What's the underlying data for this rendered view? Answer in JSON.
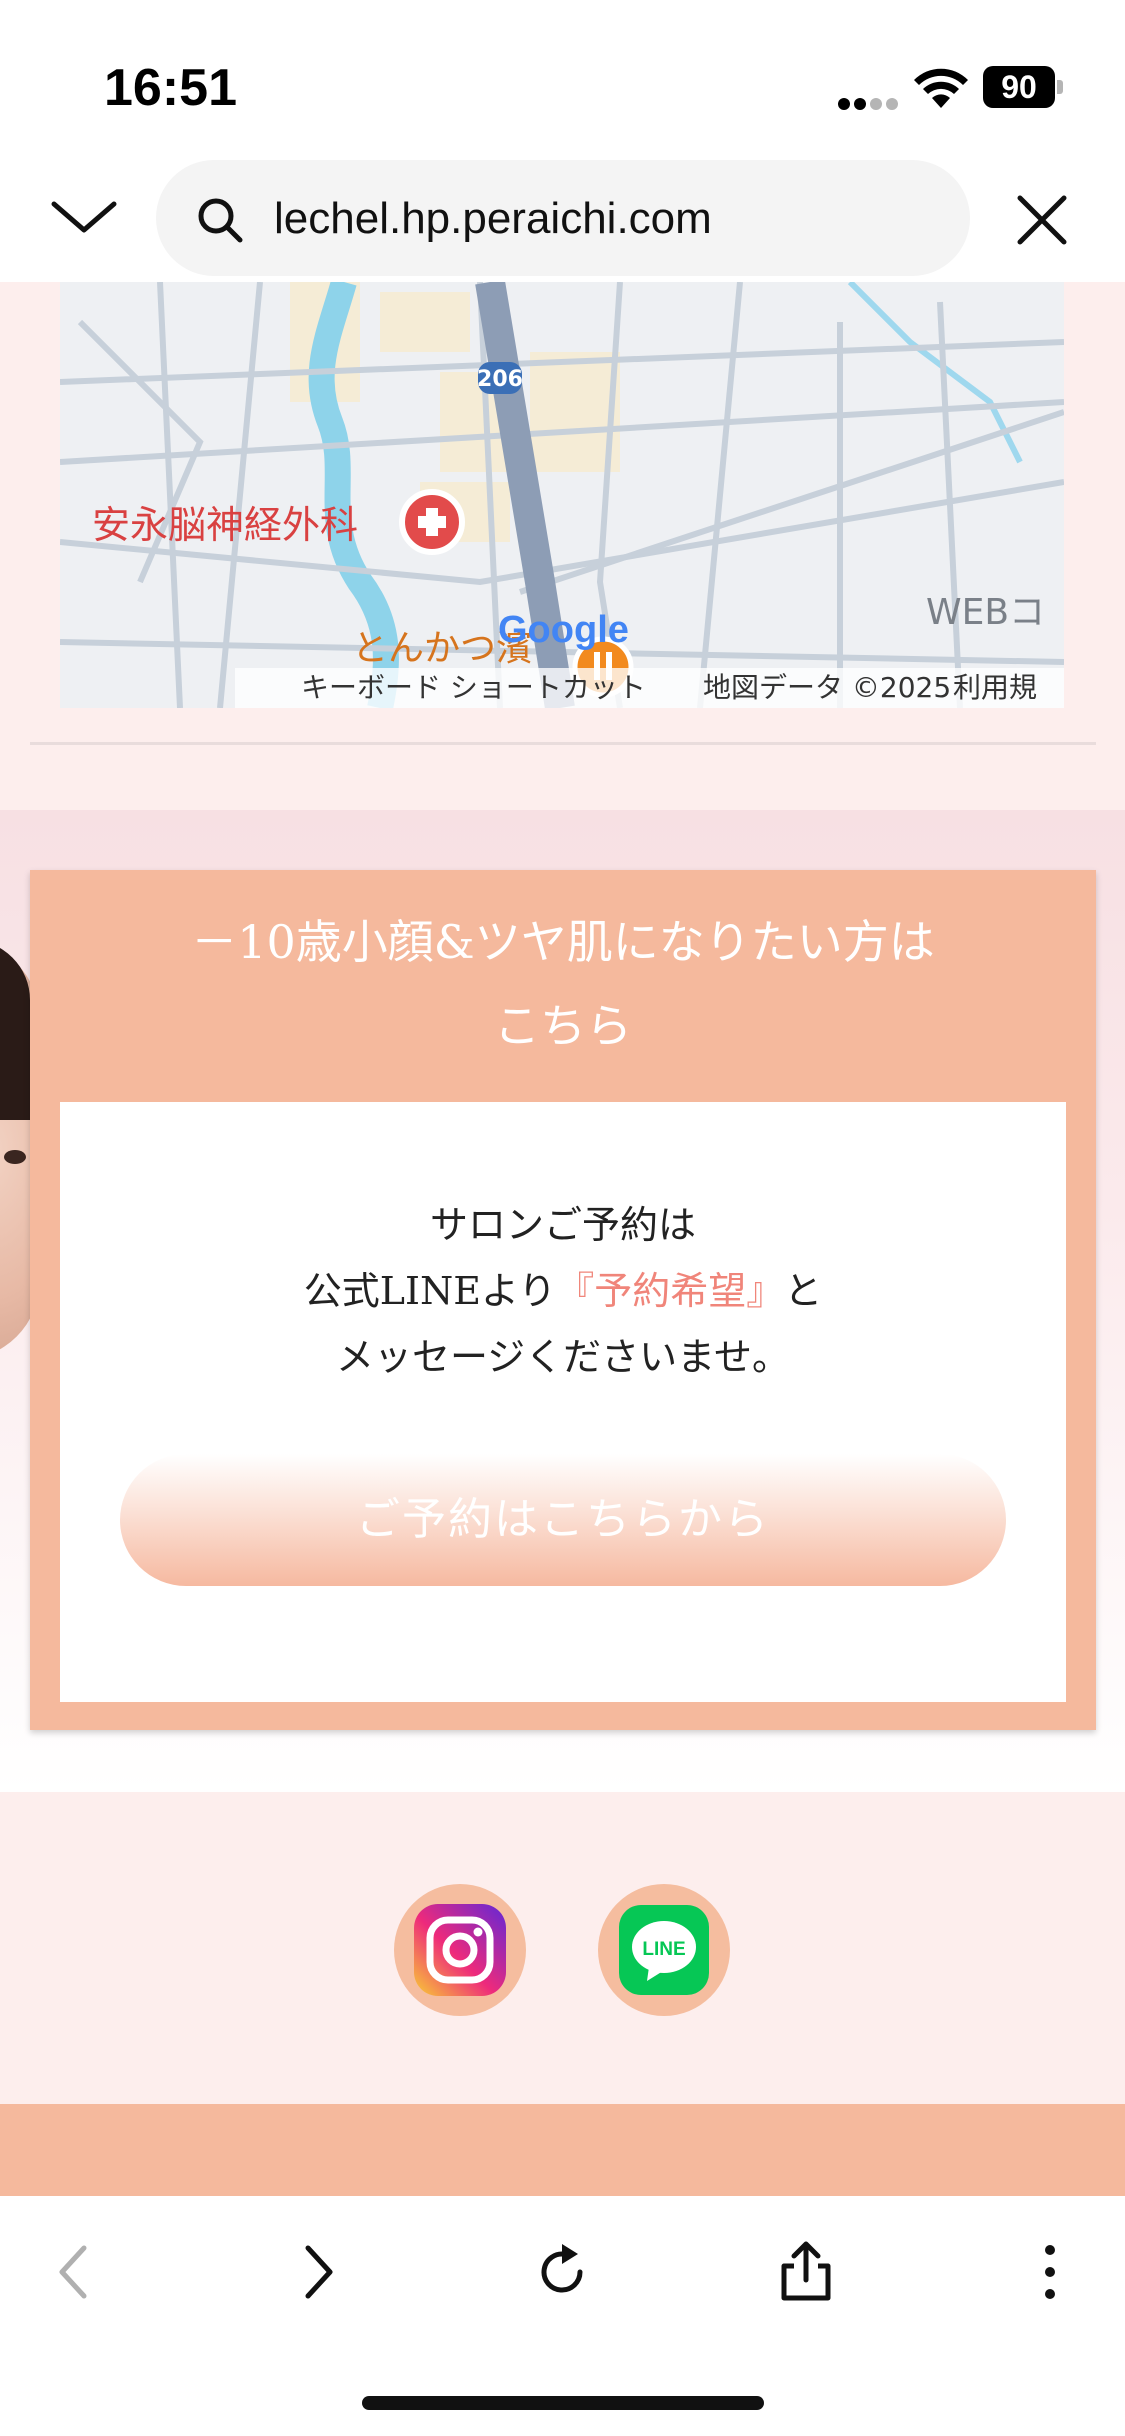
{
  "status_bar": {
    "time": "16:51",
    "battery": "90"
  },
  "browser": {
    "url": "lechel.hp.peraichi.com"
  },
  "map": {
    "places": [
      "安永脳神経外科",
      "とんかつ濱",
      "WEBコ"
    ],
    "route_label": "206",
    "logo_text": "Google",
    "attribution": {
      "shortcuts": "キーボード ショートカット",
      "map_data": "地図データ ©2025",
      "terms": "利用規約"
    }
  },
  "promo": {
    "title": "－10歳小顔&ツヤ肌になりたい方は\nこちら",
    "message_line1": "サロンご予約は",
    "message_line2_prefix": "公式LINEより",
    "message_line2_highlight": "『予約希望』",
    "message_line2_suffix": "と",
    "message_line3": "メッセージくださいませ。",
    "button_label": "ご予約はこちらから"
  },
  "social": {
    "line_badge": "LINE"
  },
  "colors": {
    "accent": "#f5b99d",
    "page_bg": "#fdeeed",
    "highlight": "#f0857a"
  },
  "icons": [
    "chevron-down-icon",
    "search-icon",
    "close-icon",
    "back-icon",
    "forward-icon",
    "reload-icon",
    "share-icon",
    "more-icon",
    "instagram-icon",
    "line-icon"
  ]
}
